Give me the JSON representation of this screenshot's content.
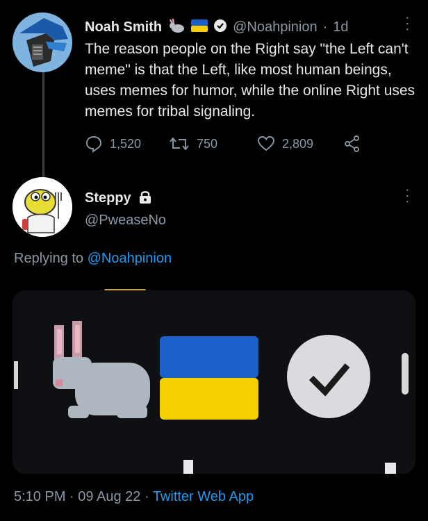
{
  "tweet": {
    "author_name": "Noah Smith",
    "handle": "@Noahpinion",
    "sep": "·",
    "age": "1d",
    "text": "The reason people on the Right say \"the Left can't meme\" is that the Left, like most human beings, uses memes for humor, while the online Right uses memes for tribal signaling.",
    "replies": "1,520",
    "retweets": "750",
    "likes": "2,809",
    "more_glyph": "···"
  },
  "reply": {
    "author_name": "Steppy",
    "handle": "@PweaseNo",
    "replying_prefix": "Replying to",
    "replying_to": "@Noahpinion",
    "more_glyph": "···"
  },
  "footer": {
    "time": "5:10 PM",
    "date": "09 Aug 22",
    "sep": "·",
    "app": "Twitter Web App"
  },
  "colors": {
    "background": "#000000",
    "link": "#1d9bf0",
    "muted": "#8b98a5",
    "flag_blue": "#1b5fc8",
    "flag_yellow": "#f5d000"
  }
}
